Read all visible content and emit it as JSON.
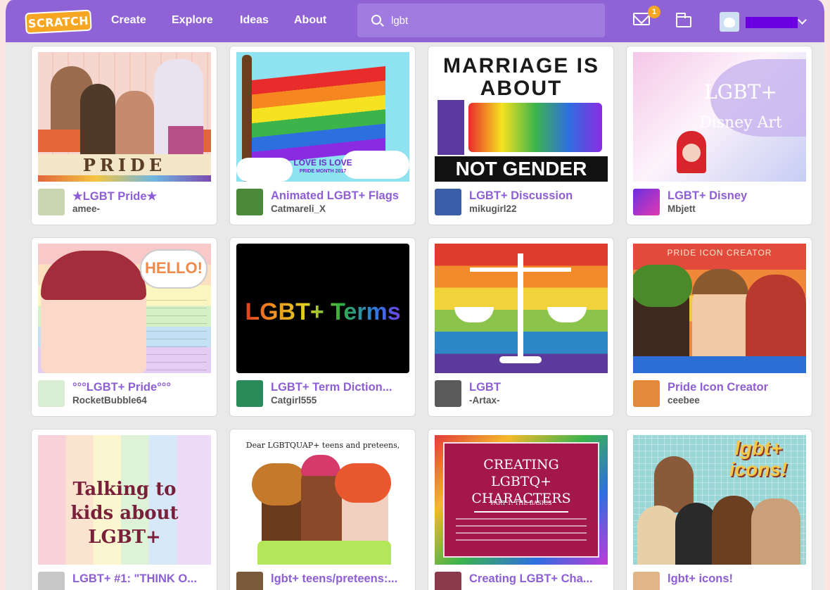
{
  "nav": {
    "logo": "SCRATCH",
    "links": [
      "Create",
      "Explore",
      "Ideas",
      "About"
    ],
    "search_value": "lgbt",
    "messages_count": "1"
  },
  "projects": [
    {
      "title": "★LGBT Pride★",
      "author": "amee-",
      "thumb_text": "PRIDE",
      "thumb_sub": ""
    },
    {
      "title": "Animated LGBT+ Flags",
      "author": "Catmareli_X",
      "thumb_text": "LOVE IS LOVE",
      "thumb_sub": "PRIDE MONTH 2017"
    },
    {
      "title": "LGBT+ Discussion",
      "author": "mikugirl22",
      "thumb_text": "MARRIAGE IS ABOUT",
      "thumb_sub": "NOT GENDER"
    },
    {
      "title": "LGBT+ Disney",
      "author": "Mbjett",
      "thumb_text": "LGBT+",
      "thumb_sub": "Disney Art"
    },
    {
      "title": "°°°LGBT+ Pride°°°",
      "author": "RocketBubble64",
      "thumb_text": "HELLO!",
      "thumb_sub": ""
    },
    {
      "title": "LGBT+ Term Diction...",
      "author": "Catgirl555",
      "thumb_text": "LGBT+ Terms",
      "thumb_sub": ""
    },
    {
      "title": "LGBT",
      "author": "-Artax-",
      "thumb_text": "",
      "thumb_sub": ""
    },
    {
      "title": "Pride Icon Creator",
      "author": "ceebee",
      "thumb_text": "PRIDE ICON CREATOR",
      "thumb_sub": ""
    },
    {
      "title": "LGBT+ #1: \"THINK O...",
      "author": "",
      "thumb_text": "Talking to kids about LGBT+",
      "thumb_sub": ""
    },
    {
      "title": "lgbt+ teens/preteens:...",
      "author": "",
      "thumb_text": "Dear LGBTQUAP+ teens and preteens,",
      "thumb_sub": ""
    },
    {
      "title": "Creating LGBT+ Cha...",
      "author": "",
      "thumb_text": "CREATING LGBTQ+ CHARACTERS",
      "thumb_sub": "PART 1: THE BASICS"
    },
    {
      "title": "lgbt+ icons!",
      "author": "",
      "thumb_text": "lgbt+ icons!",
      "thumb_sub": ""
    }
  ]
}
